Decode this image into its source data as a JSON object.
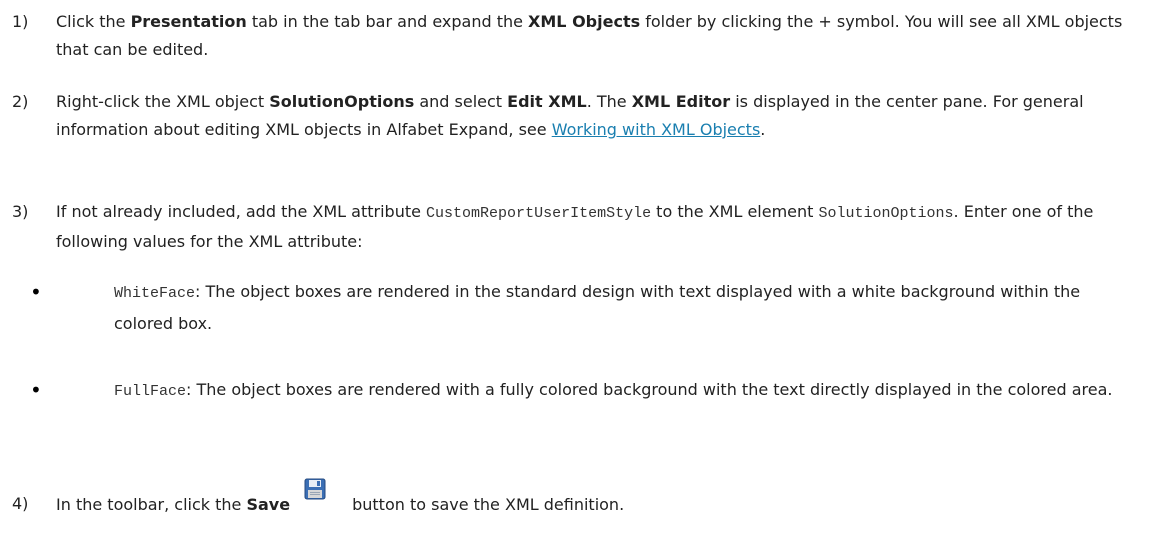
{
  "steps": [
    {
      "num": "1)",
      "t1": "Click the ",
      "b1": "Presentation",
      "t2": " tab in the tab bar and expand the ",
      "b2": "XML Objects",
      "t3": " folder by clicking the + symbol. You will see all XML objects that can be edited."
    },
    {
      "num": "2)",
      "t1": "Right-click the XML object ",
      "b1": "SolutionOptions",
      "t2": " and select ",
      "b2": "Edit XML",
      "t3": ". The ",
      "b3": "XML Editor",
      "t4": " is displayed in the center pane. For general information about editing XML objects in Alfabet Expand, see ",
      "link": "Working with XML Objects",
      "t5": "."
    },
    {
      "num": "3)",
      "t1": "If not already included, add the XML attribute ",
      "c1": "CustomReportUserItemStyle",
      "t2": " to the XML element ",
      "c2": "SolutionOptions",
      "t3": ". Enter one of the following values for the XML attribute:"
    },
    {
      "num": "4)",
      "t1": "In the toolbar, click the ",
      "b1": "Save",
      "t2": "button to save the XML definition."
    }
  ],
  "bullets": [
    {
      "dot": "•",
      "code": "WhiteFace",
      "text": ": The object boxes are rendered in the standard design with text displayed with a white background within the colored box."
    },
    {
      "dot": "•",
      "code": "FullFace",
      "text": ": The object boxes are rendered with a fully colored background with the text directly displayed in the colored area."
    }
  ],
  "icons": {
    "save": "floppy-disk-save-icon"
  },
  "colors": {
    "text": "#222222",
    "link": "#1a7fb0",
    "save_icon": "#3b6fb5"
  }
}
